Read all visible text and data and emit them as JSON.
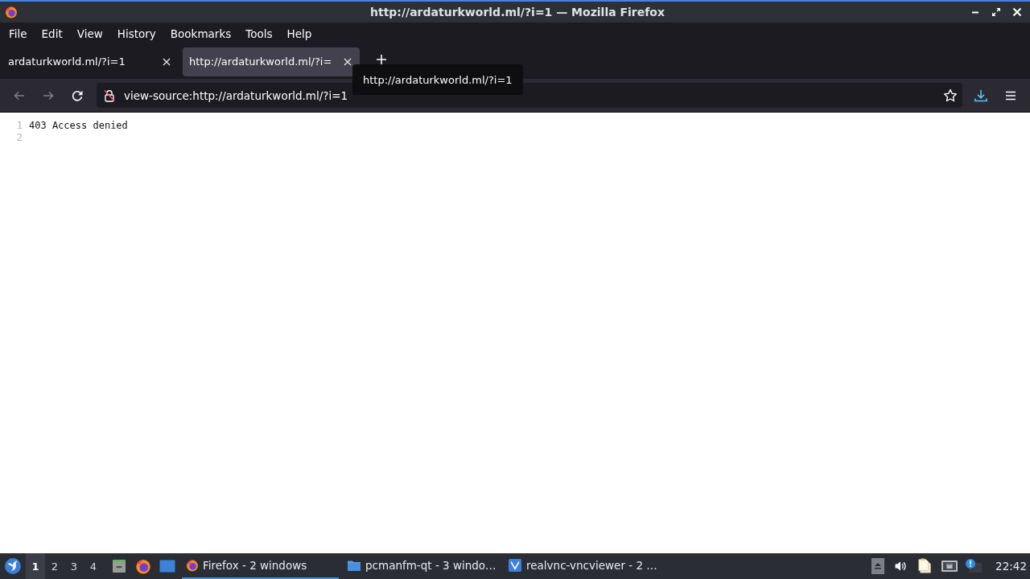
{
  "window": {
    "title": "http://ardaturkworld.ml/?i=1 — Mozilla Firefox"
  },
  "menu_bar": [
    "File",
    "Edit",
    "View",
    "History",
    "Bookmarks",
    "Tools",
    "Help"
  ],
  "tabs": [
    {
      "label": "ardaturkworld.ml/?i=1",
      "selected": false
    },
    {
      "label": "http://ardaturkworld.ml/?i=",
      "selected": true
    }
  ],
  "tooltip": "http://ardaturkworld.ml/?i=1",
  "toolbar": {
    "buttons": [
      {
        "kind": "back",
        "disabled": true
      },
      {
        "kind": "forward",
        "disabled": true
      },
      {
        "kind": "reload",
        "disabled": false
      }
    ],
    "address": "view-source:http://ardaturkworld.ml/?i=1"
  },
  "source_view": {
    "lines": [
      {
        "number": "1",
        "text": "403 Access denied"
      },
      {
        "number": "2"
      }
    ]
  },
  "taskbar": {
    "workspaces": [
      {
        "label": "1",
        "selected": true
      },
      {
        "label": "2",
        "selected": false
      },
      {
        "label": "3",
        "selected": false
      },
      {
        "label": "4",
        "selected": false
      }
    ],
    "tasks": [
      {
        "kind": "firefox",
        "label": "Firefox - 2 windows",
        "selected": true
      },
      {
        "kind": "folder",
        "label": "pcmanfm-qt - 3 windo…",
        "selected": false
      },
      {
        "kind": "vnc",
        "label": "realvnc-vncviewer - 2 …",
        "selected": false
      }
    ],
    "clock": "22:42"
  }
}
